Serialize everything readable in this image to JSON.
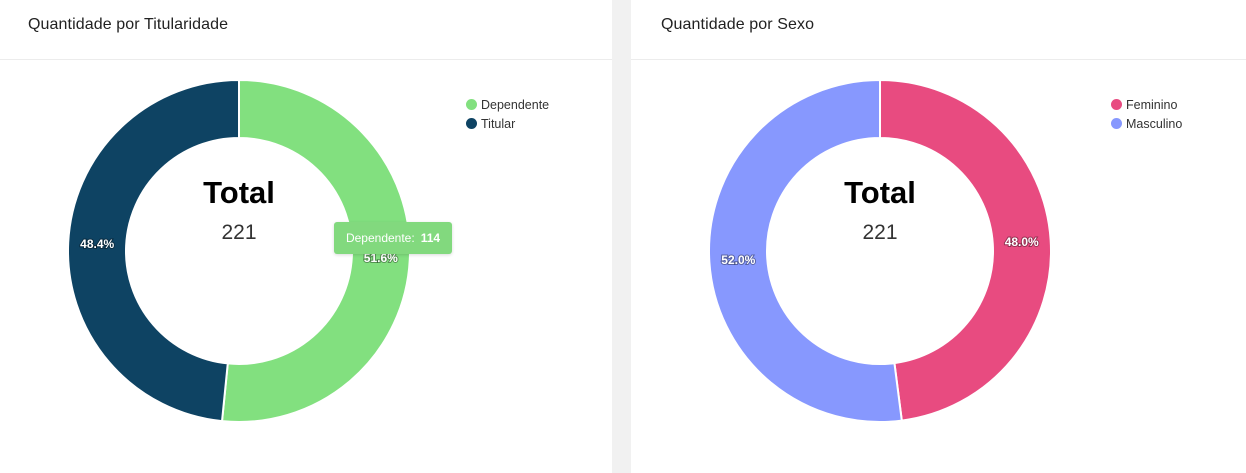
{
  "panels": [
    {
      "title": "Quantidade por Titularidade",
      "center_title": "Total",
      "center_value": "221",
      "tooltip": {
        "label": "Dependente:",
        "value": "114"
      }
    },
    {
      "title": "Quantidade por Sexo",
      "center_title": "Total",
      "center_value": "221"
    }
  ],
  "chart_data": [
    {
      "type": "pie",
      "variant": "donut",
      "title": "Quantidade por Titularidade",
      "categories": [
        "Dependente",
        "Titular"
      ],
      "values": [
        114,
        107
      ],
      "labels": [
        "51.6%",
        "48.4%"
      ],
      "colors": [
        "#82e07f",
        "#0e4363"
      ],
      "legend": "top-right"
    },
    {
      "type": "pie",
      "variant": "donut",
      "title": "Quantidade por Sexo",
      "categories": [
        "Feminino",
        "Masculino"
      ],
      "values": [
        106,
        115
      ],
      "labels": [
        "48.0%",
        "52.0%"
      ],
      "colors": [
        "#e84b80",
        "#8798fe"
      ],
      "legend": "top-right"
    }
  ]
}
